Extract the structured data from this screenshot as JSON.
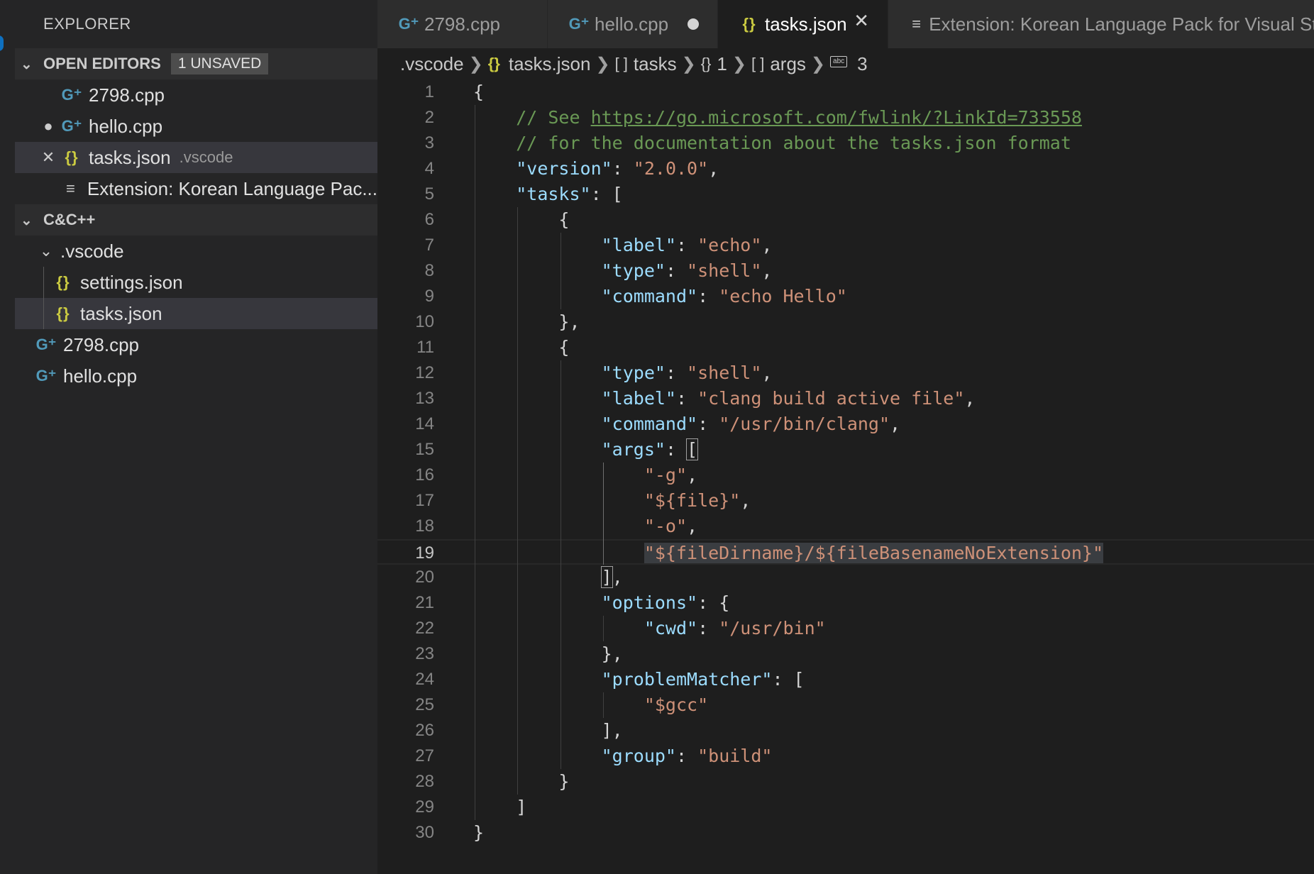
{
  "sidebar": {
    "title": "EXPLORER",
    "open_editors": {
      "label": "OPEN EDITORS",
      "badge": "1 UNSAVED",
      "items": [
        {
          "name": "2798.cpp",
          "icon": "cpp-file-icon",
          "state": ""
        },
        {
          "name": "hello.cpp",
          "icon": "cpp-file-icon",
          "state": "unsaved"
        },
        {
          "name": "tasks.json",
          "icon": "json-file-icon",
          "state": "active",
          "path": ".vscode"
        },
        {
          "name": "Extension: Korean Language Pac...",
          "icon": "extension-preview-icon",
          "state": ""
        }
      ]
    },
    "workspace": {
      "label": "C&C++",
      "folder": ".vscode",
      "folder_items": [
        "settings.json",
        "tasks.json"
      ],
      "files": [
        "2798.cpp",
        "hello.cpp"
      ]
    }
  },
  "tabs": [
    {
      "label": "2798.cpp",
      "icon": "cpp-file-icon",
      "state": ""
    },
    {
      "label": "hello.cpp",
      "icon": "cpp-file-icon",
      "state": "unsaved"
    },
    {
      "label": "tasks.json",
      "icon": "json-file-icon",
      "state": "active"
    },
    {
      "label": "Extension: Korean Language Pack for Visual Stu",
      "icon": "extension-preview-icon",
      "state": ""
    }
  ],
  "breadcrumb": [
    ".vscode",
    "tasks.json",
    "tasks",
    "1",
    "args",
    "3"
  ],
  "editor": {
    "current_line": 19,
    "lines": [
      {
        "n": "1",
        "tokens": [
          [
            "p",
            "{"
          ]
        ]
      },
      {
        "n": "2",
        "tokens": [
          [
            "c",
            "    // See "
          ],
          [
            "u",
            "https://go.microsoft.com/fwlink/?LinkId=733558"
          ]
        ]
      },
      {
        "n": "3",
        "tokens": [
          [
            "c",
            "    // for the documentation about the tasks.json format"
          ]
        ]
      },
      {
        "n": "4",
        "tokens": [
          [
            "p",
            "    "
          ],
          [
            "k",
            "\"version\""
          ],
          [
            "p",
            ": "
          ],
          [
            "s",
            "\"2.0.0\""
          ],
          [
            "p",
            ","
          ]
        ]
      },
      {
        "n": "5",
        "tokens": [
          [
            "p",
            "    "
          ],
          [
            "k",
            "\"tasks\""
          ],
          [
            "p",
            ": ["
          ]
        ]
      },
      {
        "n": "6",
        "tokens": [
          [
            "p",
            "        {"
          ]
        ]
      },
      {
        "n": "7",
        "tokens": [
          [
            "p",
            "            "
          ],
          [
            "k",
            "\"label\""
          ],
          [
            "p",
            ": "
          ],
          [
            "s",
            "\"echo\""
          ],
          [
            "p",
            ","
          ]
        ]
      },
      {
        "n": "8",
        "tokens": [
          [
            "p",
            "            "
          ],
          [
            "k",
            "\"type\""
          ],
          [
            "p",
            ": "
          ],
          [
            "s",
            "\"shell\""
          ],
          [
            "p",
            ","
          ]
        ]
      },
      {
        "n": "9",
        "tokens": [
          [
            "p",
            "            "
          ],
          [
            "k",
            "\"command\""
          ],
          [
            "p",
            ": "
          ],
          [
            "s",
            "\"echo Hello\""
          ]
        ]
      },
      {
        "n": "10",
        "tokens": [
          [
            "p",
            "        },"
          ]
        ]
      },
      {
        "n": "11",
        "tokens": [
          [
            "p",
            "        {"
          ]
        ]
      },
      {
        "n": "12",
        "tokens": [
          [
            "p",
            "            "
          ],
          [
            "k",
            "\"type\""
          ],
          [
            "p",
            ": "
          ],
          [
            "s",
            "\"shell\""
          ],
          [
            "p",
            ","
          ]
        ]
      },
      {
        "n": "13",
        "tokens": [
          [
            "p",
            "            "
          ],
          [
            "k",
            "\"label\""
          ],
          [
            "p",
            ": "
          ],
          [
            "s",
            "\"clang build active file\""
          ],
          [
            "p",
            ","
          ]
        ]
      },
      {
        "n": "14",
        "tokens": [
          [
            "p",
            "            "
          ],
          [
            "k",
            "\"command\""
          ],
          [
            "p",
            ": "
          ],
          [
            "s",
            "\"/usr/bin/clang\""
          ],
          [
            "p",
            ","
          ]
        ]
      },
      {
        "n": "15",
        "tokens": [
          [
            "p",
            "            "
          ],
          [
            "k",
            "\"args\""
          ],
          [
            "p",
            ": "
          ],
          [
            "b",
            "["
          ]
        ]
      },
      {
        "n": "16",
        "tokens": [
          [
            "p",
            "                "
          ],
          [
            "s",
            "\"-g\""
          ],
          [
            "p",
            ","
          ]
        ]
      },
      {
        "n": "17",
        "tokens": [
          [
            "p",
            "                "
          ],
          [
            "s",
            "\"${file}\""
          ],
          [
            "p",
            ","
          ]
        ]
      },
      {
        "n": "18",
        "tokens": [
          [
            "p",
            "                "
          ],
          [
            "s",
            "\"-o\""
          ],
          [
            "p",
            ","
          ]
        ]
      },
      {
        "n": "19",
        "tokens": [
          [
            "p",
            "                "
          ],
          [
            "sel",
            "\"${fileDirname}/${fileBasenameNoExtension}\""
          ]
        ]
      },
      {
        "n": "20",
        "tokens": [
          [
            "p",
            "            "
          ],
          [
            "b",
            "]"
          ],
          [
            "p",
            ","
          ]
        ]
      },
      {
        "n": "21",
        "tokens": [
          [
            "p",
            "            "
          ],
          [
            "k",
            "\"options\""
          ],
          [
            "p",
            ": {"
          ]
        ]
      },
      {
        "n": "22",
        "tokens": [
          [
            "p",
            "                "
          ],
          [
            "k",
            "\"cwd\""
          ],
          [
            "p",
            ": "
          ],
          [
            "s",
            "\"/usr/bin\""
          ]
        ]
      },
      {
        "n": "23",
        "tokens": [
          [
            "p",
            "            },"
          ]
        ]
      },
      {
        "n": "24",
        "tokens": [
          [
            "p",
            "            "
          ],
          [
            "k",
            "\"problemMatcher\""
          ],
          [
            "p",
            ": ["
          ]
        ]
      },
      {
        "n": "25",
        "tokens": [
          [
            "p",
            "                "
          ],
          [
            "s",
            "\"$gcc\""
          ]
        ]
      },
      {
        "n": "26",
        "tokens": [
          [
            "p",
            "            ],"
          ]
        ]
      },
      {
        "n": "27",
        "tokens": [
          [
            "p",
            "            "
          ],
          [
            "k",
            "\"group\""
          ],
          [
            "p",
            ": "
          ],
          [
            "s",
            "\"build\""
          ]
        ]
      },
      {
        "n": "28",
        "tokens": [
          [
            "p",
            "        }"
          ]
        ]
      },
      {
        "n": "29",
        "tokens": [
          [
            "p",
            "    ]"
          ]
        ]
      },
      {
        "n": "30",
        "tokens": [
          [
            "p",
            "}"
          ]
        ]
      }
    ]
  },
  "colors": {
    "editor_bg": "#1e1e1e",
    "sidebar_bg": "#252526",
    "json_key": "#9cdcfe",
    "json_string": "#ce9178",
    "comment": "#6a9955",
    "cpp_icon": "#519aba",
    "json_icon": "#cbcb41"
  }
}
